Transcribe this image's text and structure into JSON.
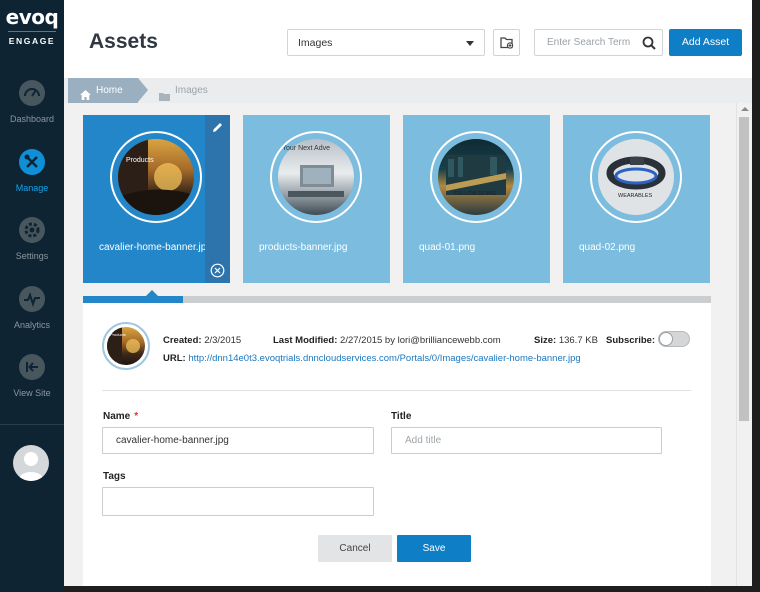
{
  "sidebar": {
    "brand": "evoq",
    "brand_sub": "ENGAGE",
    "items": [
      {
        "label": "Dashboard",
        "icon": "dashboard-icon"
      },
      {
        "label": "Manage",
        "icon": "manage-icon",
        "active": true
      },
      {
        "label": "Settings",
        "icon": "settings-icon"
      },
      {
        "label": "Analytics",
        "icon": "analytics-icon"
      },
      {
        "label": "View Site",
        "icon": "view-site-icon"
      }
    ],
    "accent": "#0e8fd6"
  },
  "header": {
    "title": "Assets",
    "folder_select": "Images",
    "search_placeholder": "Enter Search Term",
    "add_button": "Add Asset"
  },
  "breadcrumb": {
    "home": "Home",
    "current": "Images"
  },
  "assets": [
    {
      "name": "cavalier-home-banner.jpg",
      "selected": true,
      "thumb_caption": "Products"
    },
    {
      "name": "products-banner.jpg",
      "selected": false,
      "thumb_caption": "Your Next Adve"
    },
    {
      "name": "quad-01.png",
      "selected": false,
      "thumb_caption": "FELLOW GOING"
    },
    {
      "name": "quad-02.png",
      "selected": false,
      "thumb_caption": "WEARABLES"
    }
  ],
  "selection_progress": 0.16,
  "detail": {
    "thumb_caption": "Products",
    "created_label": "Created:",
    "created_value": "2/3/2015",
    "modified_label": "Last Modified:",
    "modified_value": "2/27/2015 by lori@brilliancewebb.com",
    "size_label": "Size:",
    "size_value": "136.7 KB",
    "subscribe_label": "Subscribe:",
    "subscribed": false,
    "url_label": "URL:",
    "url_value": "http://dnn14e0t3.evoqtrials.dnncloudservices.com/Portals/0/Images/cavalier-home-banner.jpg"
  },
  "form": {
    "name_label": "Name",
    "required_mark": "*",
    "name_value": "cavalier-home-banner.jpg",
    "title_label": "Title",
    "title_placeholder": "Add title",
    "tags_label": "Tags",
    "tags_value": "",
    "cancel_label": "Cancel",
    "save_label": "Save"
  },
  "colors": {
    "primary": "#0e7fc7",
    "tile": "#7bbcdf",
    "tile_selected": "#2386c8"
  }
}
